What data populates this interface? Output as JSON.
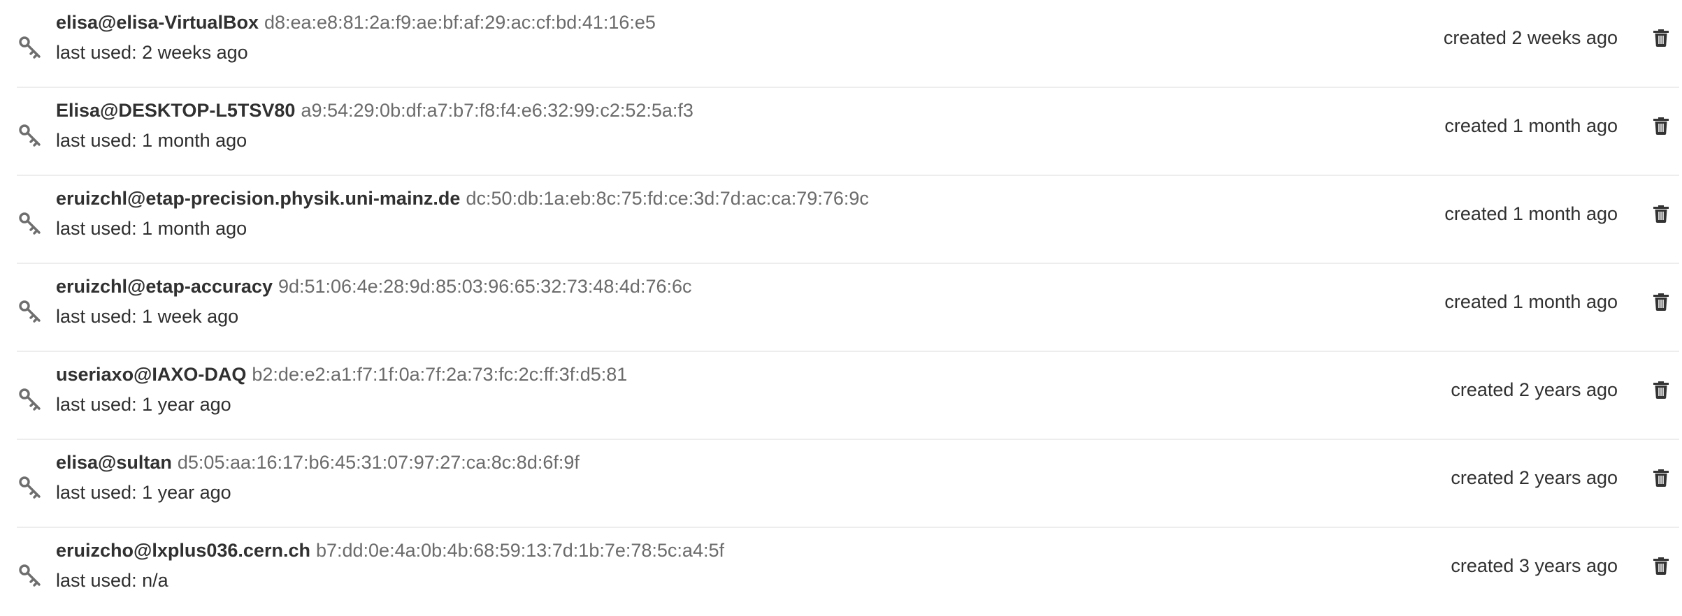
{
  "ssh_keys": [
    {
      "title": "elisa@elisa-VirtualBox",
      "fingerprint": "d8:ea:e8:81:2a:f9:ae:bf:af:29:ac:cf:bd:41:16:e5",
      "last_used": "last used: 2 weeks ago",
      "created": "created 2 weeks ago"
    },
    {
      "title": "Elisa@DESKTOP-L5TSV80",
      "fingerprint": "a9:54:29:0b:df:a7:b7:f8:f4:e6:32:99:c2:52:5a:f3",
      "last_used": "last used: 1 month ago",
      "created": "created 1 month ago"
    },
    {
      "title": "eruizchl@etap-precision.physik.uni-mainz.de",
      "fingerprint": "dc:50:db:1a:eb:8c:75:fd:ce:3d:7d:ac:ca:79:76:9c",
      "last_used": "last used: 1 month ago",
      "created": "created 1 month ago"
    },
    {
      "title": "eruizchl@etap-accuracy",
      "fingerprint": "9d:51:06:4e:28:9d:85:03:96:65:32:73:48:4d:76:6c",
      "last_used": "last used: 1 week ago",
      "created": "created 1 month ago"
    },
    {
      "title": "useriaxo@IAXO-DAQ",
      "fingerprint": "b2:de:e2:a1:f7:1f:0a:7f:2a:73:fc:2c:ff:3f:d5:81",
      "last_used": "last used: 1 year ago",
      "created": "created 2 years ago"
    },
    {
      "title": "elisa@sultan",
      "fingerprint": "d5:05:aa:16:17:b6:45:31:07:97:27:ca:8c:8d:6f:9f",
      "last_used": "last used: 1 year ago",
      "created": "created 2 years ago"
    },
    {
      "title": "eruizcho@lxplus036.cern.ch",
      "fingerprint": "b7:dd:0e:4a:0b:4b:68:59:13:7d:1b:7e:78:5c:a4:5f",
      "last_used": "last used: n/a",
      "created": "created 3 years ago"
    }
  ],
  "icons": {
    "key": "key-icon",
    "delete": "trash-icon"
  },
  "colors": {
    "title": "#303030",
    "fingerprint": "#6b6b6b",
    "icon": "#6e6e6e",
    "divider": "#ededed"
  }
}
